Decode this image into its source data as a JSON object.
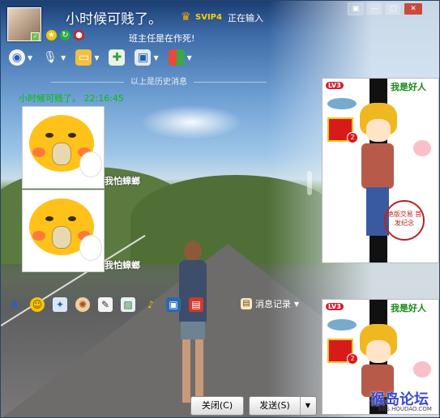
{
  "header": {
    "contact_name": "小时候可贱了。",
    "svip_label": "SVIP4",
    "typing_status": "正在输入",
    "signature": "班主任是在作死!"
  },
  "window_buttons": {
    "skin": "▣",
    "minimize": "—",
    "maximize": "□",
    "close": "✕"
  },
  "toolbar": {
    "items": [
      "video-call",
      "voice-call",
      "file-transfer",
      "add-chat",
      "remote-assist",
      "apps"
    ]
  },
  "chat": {
    "history_divider": "以上是历史消息",
    "message_header": "小时候可贱了。 22:16:45",
    "sticker_caption_1": "我怕蟑螂",
    "sticker_caption_2": "我怕蟑螂"
  },
  "input_toolbar": {
    "history_label": "消息记录"
  },
  "buttons": {
    "close": "关闭(C)",
    "send": "发送(S)"
  },
  "show_panel": {
    "level_badge": "LV3",
    "title": "我是好人",
    "gift_count": "2",
    "stamp_text": "绝版交易 首发纪念"
  },
  "watermark": {
    "text": "猴岛论坛",
    "url": "BBS.HOUDAO.COM"
  }
}
